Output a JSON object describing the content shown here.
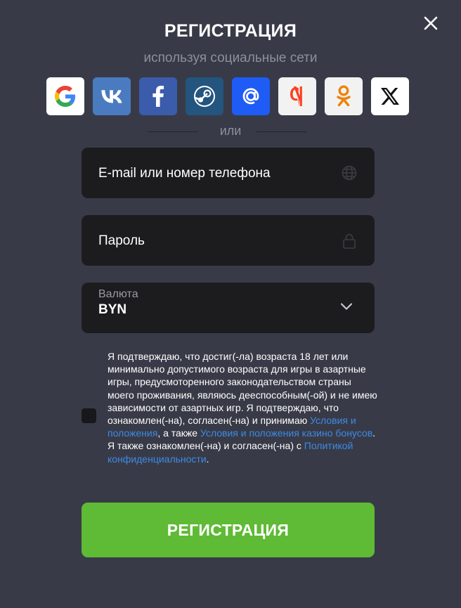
{
  "title": "РЕГИСТРАЦИЯ",
  "subtitle": "используя социальные сети",
  "social": [
    {
      "id": "google",
      "icon": "google-icon",
      "bg": "#ffffff"
    },
    {
      "id": "vk",
      "icon": "vk-icon",
      "bg": "#4a7bc0",
      "glyph": "VK"
    },
    {
      "id": "facebook",
      "icon": "facebook-icon",
      "bg": "#3b5bab",
      "glyph": "f"
    },
    {
      "id": "steam",
      "icon": "steam-icon",
      "bg": "#23557f"
    },
    {
      "id": "mailru",
      "icon": "at-sign-icon",
      "bg": "#1f5bf5",
      "glyph": "@"
    },
    {
      "id": "yandex",
      "icon": "yandex-icon",
      "bg": "#f2f2f2",
      "glyph": "Я"
    },
    {
      "id": "odnoklassniki",
      "icon": "ok-icon",
      "bg": "#f2f2f2"
    },
    {
      "id": "x",
      "icon": "x-icon",
      "bg": "#ffffff"
    }
  ],
  "divider_text": "или",
  "email_field": {
    "label": "E-mail или номер телефона",
    "icon": "globe-icon"
  },
  "password_field": {
    "label": "Пароль",
    "icon": "lock-icon"
  },
  "currency": {
    "label": "Валюта",
    "value": "BYN"
  },
  "consent": {
    "part1": "Я подтверждаю, что достиг(-ла) возраста 18 лет или минимально допустимого возраста для игры в азартные игры, предусмоторенного законодательством страны моего проживания, являюсь дееспособным(-ой) и не имею зависимости от азартных игр. Я подтверждаю, что ознакомлен(-на), согласен(-на) и принимаю ",
    "link1": "Условия и положения",
    "part2": ", а также ",
    "link2": "Условия и положения казино бонусов",
    "part3": ". Я также ознакомлен(-на) и согласен(-на) с ",
    "link3": "Политикой конфиденциальности",
    "part4": "."
  },
  "register_button": "РЕГИСТРАЦИЯ",
  "colors": {
    "background": "#383b47",
    "field_bg": "#1c1c1f",
    "accent_green": "#5fba35",
    "link": "#3d8ae6",
    "muted": "#8d909b"
  }
}
